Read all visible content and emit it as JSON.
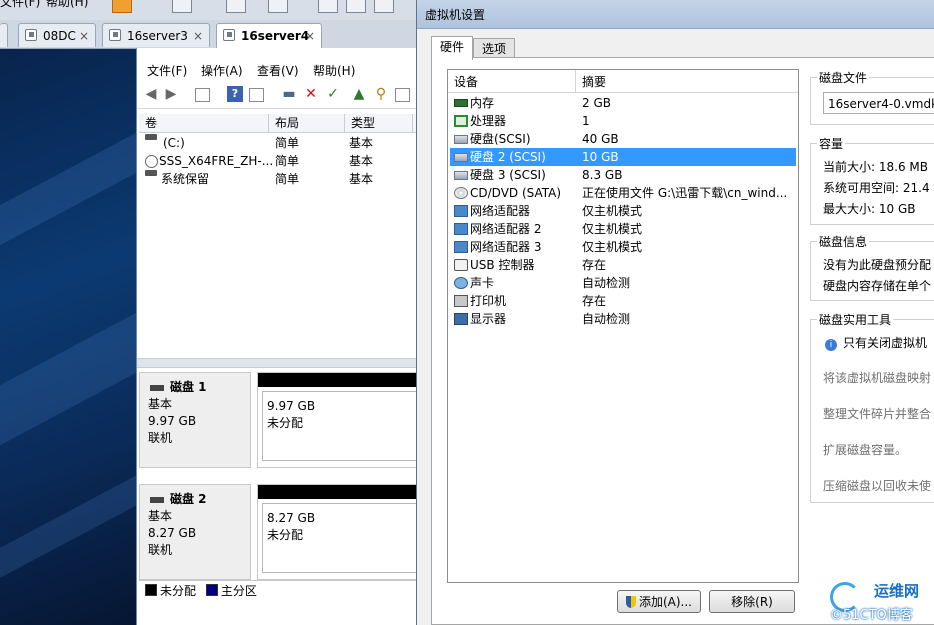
{
  "vmware": {
    "menu_file": "文件(F)",
    "menu_help": "帮助(H)",
    "tabs": [
      {
        "label": "08DC",
        "close": "×"
      },
      {
        "label": "16server3",
        "close": "×"
      },
      {
        "label": "16server4",
        "close": "×"
      }
    ],
    "active_tab": 2
  },
  "disk_mgmt": {
    "menu": [
      "文件(F)",
      "操作(A)",
      "查看(V)",
      "帮助(H)"
    ],
    "volume_headers": [
      "卷",
      "布局",
      "类型"
    ],
    "volumes": [
      {
        "name": "(C:)",
        "layout": "简单",
        "type": "基本",
        "icon": "drive-icon"
      },
      {
        "name": "SSS_X64FRE_ZH-...",
        "layout": "简单",
        "type": "基本",
        "icon": "cd-icon"
      },
      {
        "name": "系统保留",
        "layout": "简单",
        "type": "基本",
        "icon": "drive-icon"
      }
    ],
    "disks": [
      {
        "title": "磁盘 1",
        "kind": "基本",
        "size": "9.97 GB",
        "status": "联机",
        "part_size": "9.97 GB",
        "part_state": "未分配"
      },
      {
        "title": "磁盘 2",
        "kind": "基本",
        "size": "8.27 GB",
        "status": "联机",
        "part_size": "8.27 GB",
        "part_state": "未分配"
      }
    ],
    "legend": {
      "unallocated": "未分配",
      "primary": "主分区",
      "unallocated_color": "#000000",
      "primary_color": "#000080"
    }
  },
  "dialog": {
    "title": "虚拟机设置",
    "tabs": [
      "硬件",
      "选项"
    ],
    "col_device": "设备",
    "col_summary": "摘要",
    "devices": [
      {
        "name": "内存",
        "summary": "2 GB",
        "icon": "memory-icon"
      },
      {
        "name": "处理器",
        "summary": "1",
        "icon": "processor-icon"
      },
      {
        "name": "硬盘(SCSI)",
        "summary": "40 GB",
        "icon": "hard-disk-icon"
      },
      {
        "name": "硬盘 2 (SCSI)",
        "summary": "10 GB",
        "icon": "hard-disk-icon"
      },
      {
        "name": "硬盘 3 (SCSI)",
        "summary": "8.3 GB",
        "icon": "hard-disk-icon"
      },
      {
        "name": "CD/DVD (SATA)",
        "summary": "正在使用文件 G:\\迅雷下载\\cn_wind...",
        "icon": "cd-dvd-icon"
      },
      {
        "name": "网络适配器",
        "summary": "仅主机模式",
        "icon": "network-adapter-icon"
      },
      {
        "name": "网络适配器 2",
        "summary": "仅主机模式",
        "icon": "network-adapter-icon"
      },
      {
        "name": "网络适配器 3",
        "summary": "仅主机模式",
        "icon": "network-adapter-icon"
      },
      {
        "name": "USB 控制器",
        "summary": "存在",
        "icon": "usb-icon"
      },
      {
        "name": "声卡",
        "summary": "自动检测",
        "icon": "sound-card-icon"
      },
      {
        "name": "打印机",
        "summary": "存在",
        "icon": "printer-icon"
      },
      {
        "name": "显示器",
        "summary": "自动检测",
        "icon": "display-icon"
      }
    ],
    "selected_index": 3,
    "disk_file": {
      "title": "磁盘文件",
      "value": "16server4-0.vmdk"
    },
    "capacity": {
      "title": "容量",
      "current": "当前大小: 18.6 MB",
      "available": "系统可用空间: 21.4",
      "max": "最大大小: 10 GB"
    },
    "disk_info": {
      "title": "磁盘信息",
      "line1": "没有为此硬盘预分配",
      "line2": "硬盘内容存储在单个"
    },
    "utilities": {
      "title": "磁盘实用工具",
      "note": "只有关闭虚拟机",
      "map": "将该虚拟机磁盘映射",
      "defrag": "整理文件碎片并整合",
      "expand": "扩展磁盘容量。",
      "compact": "压缩磁盘以回收未使"
    },
    "add_button": "添加(A)...",
    "remove_button": "移除(R)"
  },
  "watermark": {
    "line1": "运维网",
    "line2": "©51CTO博客"
  }
}
